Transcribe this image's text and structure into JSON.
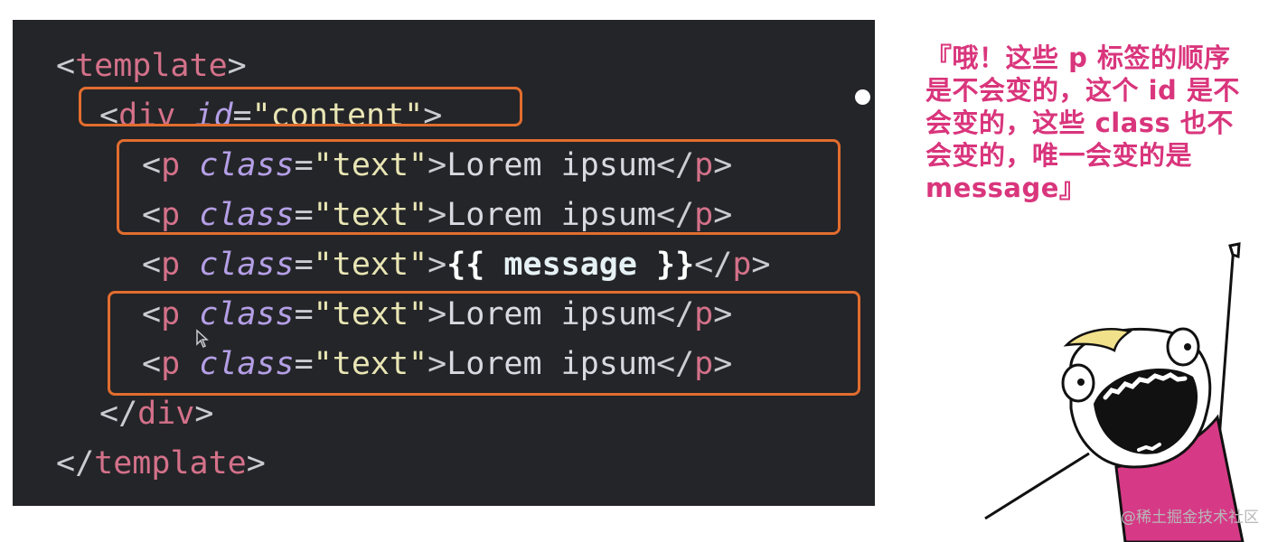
{
  "code": {
    "line1": {
      "open": "<",
      "tag": "template",
      "close": ">"
    },
    "line2": {
      "open": "<",
      "tag": "div",
      "attr": "id",
      "eq": "=",
      "value": "\"content\"",
      "close": ">"
    },
    "p_line": {
      "open": "<",
      "tag": "p",
      "attr": "class",
      "eq": "=",
      "value": "\"text\"",
      "gt": ">",
      "text": "Lorem ipsum",
      "end_open": "</",
      "end_tag": "p",
      "end_close": ">"
    },
    "message_line": {
      "open": "<",
      "tag": "p",
      "attr": "class",
      "eq": "=",
      "value": "\"text\"",
      "gt": ">",
      "brace_open": "{{",
      "expr": "message",
      "brace_close": "}}",
      "end_open": "</",
      "end_tag": "p",
      "end_close": ">"
    },
    "line8": {
      "open": "</",
      "tag": "div",
      "close": ">"
    },
    "line9": {
      "open": "</",
      "tag": "template",
      "close": ">"
    }
  },
  "caption": {
    "lines": [
      "『哦！这些 p 标签的顺序",
      "是不会变的，这个 id 是不",
      "会变的，这些 class 也不",
      "会变的，唯一会变的是",
      "message』"
    ],
    "color": "#d9357c"
  },
  "highlight_color": "#e26d2f",
  "watermark": "@稀土掘金技术社区"
}
